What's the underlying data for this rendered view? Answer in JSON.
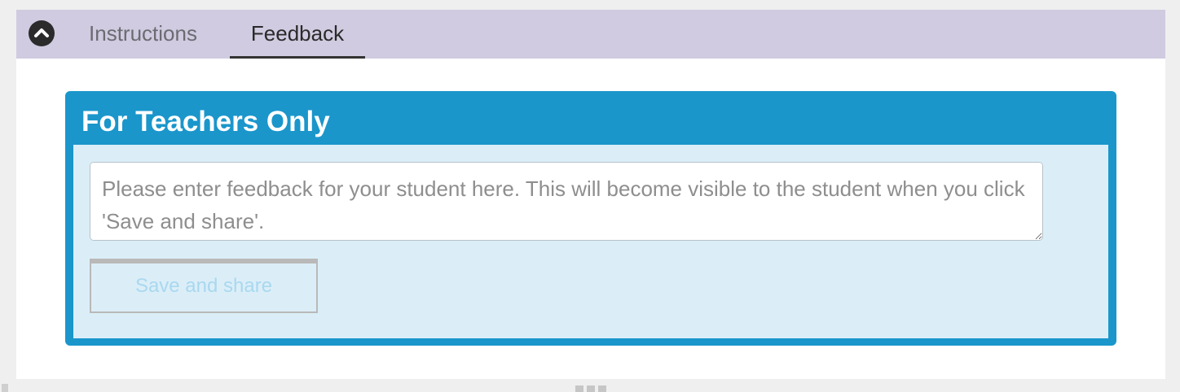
{
  "tabs": {
    "instructions_label": "Instructions",
    "feedback_label": "Feedback",
    "active": "Feedback"
  },
  "collapse_icon": "chevron-up-icon",
  "teacher_panel": {
    "title": "For Teachers Only",
    "feedback_placeholder": "Please enter feedback for your student here. This will become visible to the student when you click 'Save and share'.",
    "feedback_value": "",
    "save_button_label": "Save and share",
    "save_button_enabled": false
  },
  "colors": {
    "tabbar": "#d0cbe0",
    "card_header": "#1a96cb",
    "card_body": "#dbeef8",
    "disabled_text": "#a9d8ef"
  }
}
